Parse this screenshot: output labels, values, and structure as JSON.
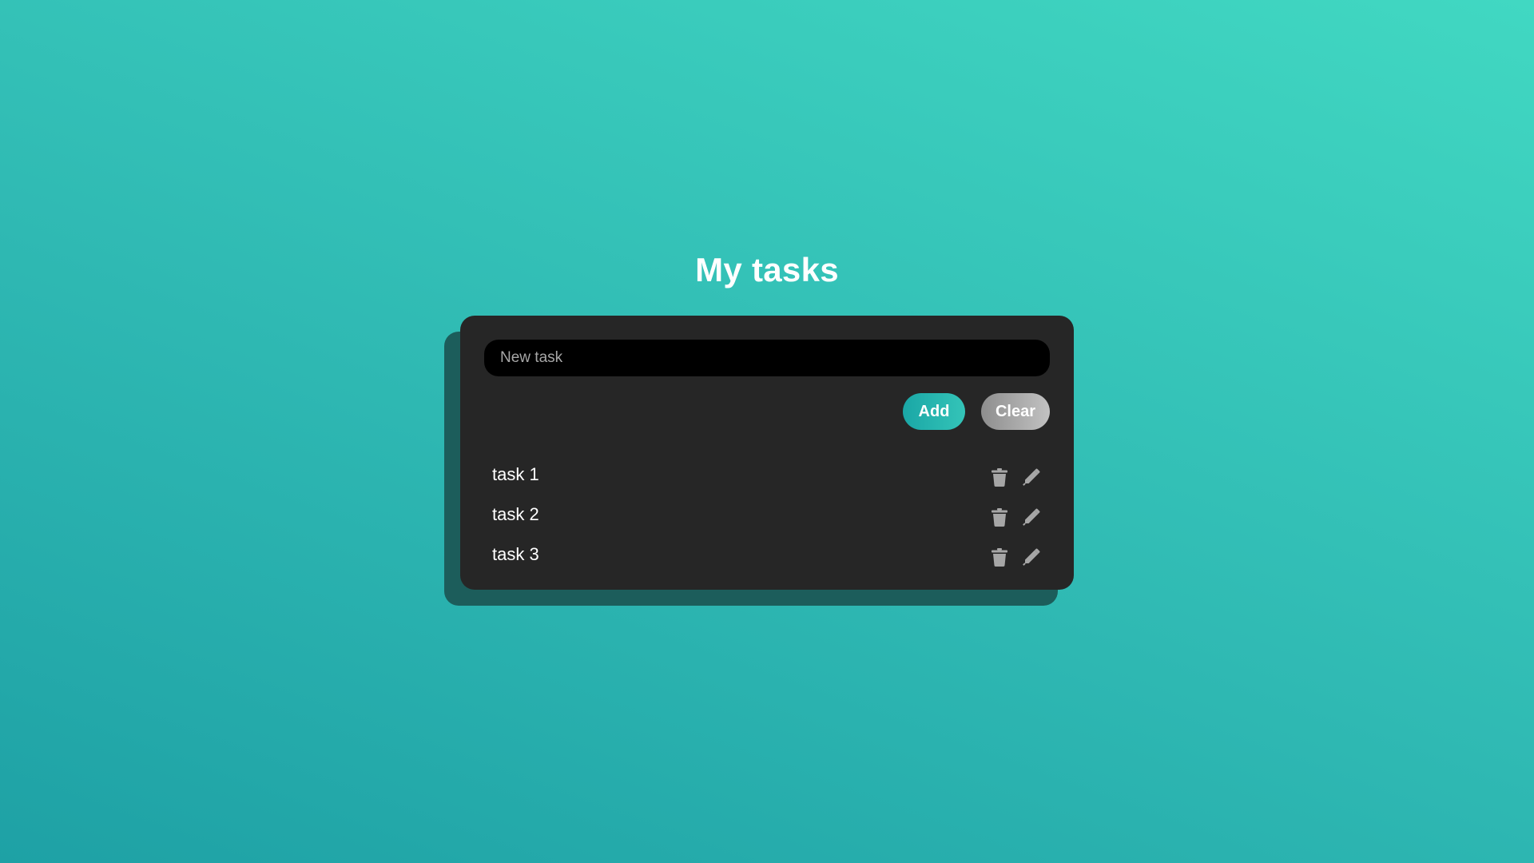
{
  "page": {
    "title": "My tasks"
  },
  "form": {
    "input_placeholder": "New task",
    "input_value": "",
    "add_label": "Add",
    "clear_label": "Clear"
  },
  "tasks": [
    {
      "label": "task 1"
    },
    {
      "label": "task 2"
    },
    {
      "label": "task 3"
    }
  ],
  "icons": {
    "delete": "trash-icon",
    "edit": "pencil-icon"
  },
  "colors": {
    "background_start": "#1ea1a5",
    "background_end": "#41d8c2",
    "card": "#262626",
    "card_shadow": "#1c5d5b",
    "input": "#000000",
    "add_button": "#24b4ae",
    "clear_button": "#a8a8a8",
    "icon": "#a6a6a6"
  }
}
